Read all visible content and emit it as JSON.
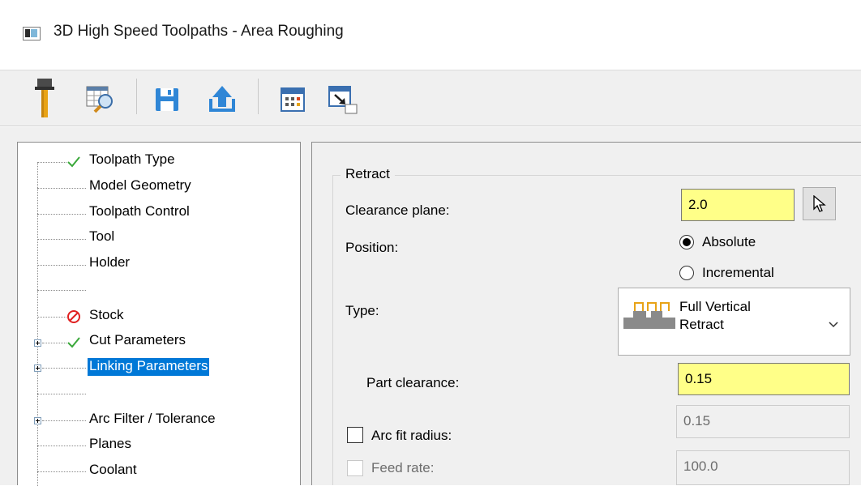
{
  "window": {
    "title": "3D High Speed Toolpaths - Area Roughing"
  },
  "toolbar": {
    "items": [
      "tool-icon",
      "preview-table-icon",
      "save-icon",
      "upload-icon",
      "calculator-icon",
      "minimize-to-box-icon"
    ]
  },
  "tree": {
    "items": [
      {
        "label": "Toolpath Type",
        "status": "check"
      },
      {
        "label": "Model Geometry",
        "status": ""
      },
      {
        "label": "Toolpath Control",
        "status": ""
      },
      {
        "label": "Tool",
        "status": ""
      },
      {
        "label": "Holder",
        "status": ""
      },
      {
        "label": "Stock",
        "status": "error"
      },
      {
        "label": "Cut Parameters",
        "status": "check",
        "expandable": true
      },
      {
        "label": "Linking Parameters",
        "status": "",
        "expandable": true,
        "selected": true
      },
      {
        "label": "Arc Filter / Tolerance",
        "status": "",
        "expandable": true
      },
      {
        "label": "Planes",
        "status": ""
      },
      {
        "label": "Coolant",
        "status": ""
      }
    ]
  },
  "retract": {
    "group_label": "Retract",
    "clearance_plane_label": "Clearance plane:",
    "clearance_plane_value": "2.0",
    "position_label": "Position:",
    "position_options": [
      "Absolute",
      "Incremental"
    ],
    "position_selected": "Absolute",
    "type_label": "Type:",
    "type_value_line1": "Full Vertical",
    "type_value_line2": "Retract",
    "part_clearance_label": "Part clearance:",
    "part_clearance_value": "0.15",
    "arc_fit_label": "Arc fit radius:",
    "arc_fit_value": "0.15",
    "feed_rate_label": "Feed rate:",
    "feed_rate_value": "100.0"
  },
  "colors": {
    "highlight": "#0078d7",
    "required_field": "#ffff88",
    "check": "#3aa83a",
    "error": "#e02020"
  }
}
